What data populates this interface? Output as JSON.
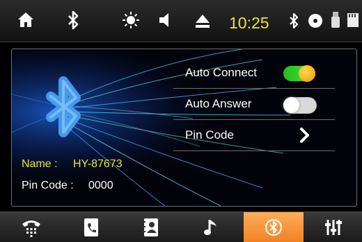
{
  "status_bar": {
    "time": "10:25",
    "icons": [
      "home-icon",
      "bluetooth-icon",
      "brightness-icon",
      "volume-icon",
      "eject-icon",
      "bluetooth-status-icon",
      "disc-icon",
      "usb-icon",
      "sd-card-icon"
    ]
  },
  "settings": {
    "auto_connect": {
      "label": "Auto Connect",
      "enabled": true
    },
    "auto_answer": {
      "label": "Auto Answer",
      "enabled": false
    },
    "pin_code": {
      "label": "Pin Code"
    }
  },
  "device_info": {
    "name_label": "Name :",
    "name_value": "HY-87673",
    "pin_label": "Pin Code :",
    "pin_value": "0000"
  },
  "bottom_nav": {
    "tabs": [
      {
        "icon": "phone-dialpad-icon"
      },
      {
        "icon": "call-log-icon"
      },
      {
        "icon": "contacts-icon"
      },
      {
        "icon": "music-icon"
      },
      {
        "icon": "bluetooth-settings-icon",
        "active": true
      },
      {
        "icon": "equalizer-icon"
      }
    ]
  },
  "colors": {
    "accent": "#f08324",
    "highlight_text": "#e8e43a",
    "toggle_on": "#2ec72a",
    "knob_on": "#f5a814"
  }
}
